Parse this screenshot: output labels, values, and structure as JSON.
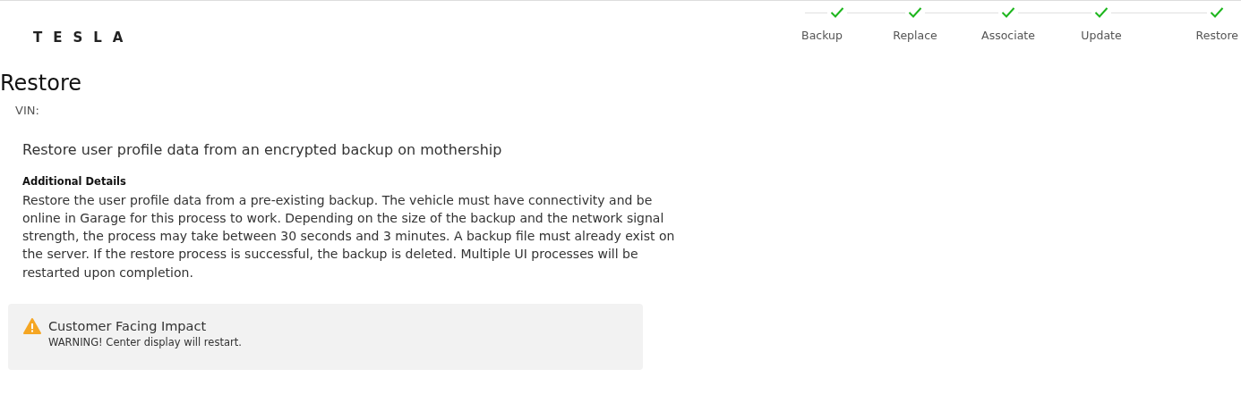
{
  "logo": "TESLA",
  "steps": [
    {
      "label": "Backup",
      "completed": true
    },
    {
      "label": "Replace",
      "completed": true
    },
    {
      "label": "Associate",
      "completed": true
    },
    {
      "label": "Update",
      "completed": true
    },
    {
      "label": "Restore",
      "completed": true
    }
  ],
  "title": "Restore",
  "vin_label": "VIN:",
  "summary": "Restore user profile data from an encrypted backup on mothership",
  "details_heading": "Additional Details",
  "details": "Restore the user profile data from a pre-existing backup. The vehicle must have connectivity and be online in Garage for this process to work. Depending on the size of the backup and the network signal strength, the process may take between 30 seconds and 3 minutes. A backup file must already exist on the server. If the restore process is successful, the backup is deleted. Multiple UI processes will be restarted upon completion.",
  "impact": {
    "title": "Customer Facing Impact",
    "message": "WARNING! Center display will restart."
  }
}
